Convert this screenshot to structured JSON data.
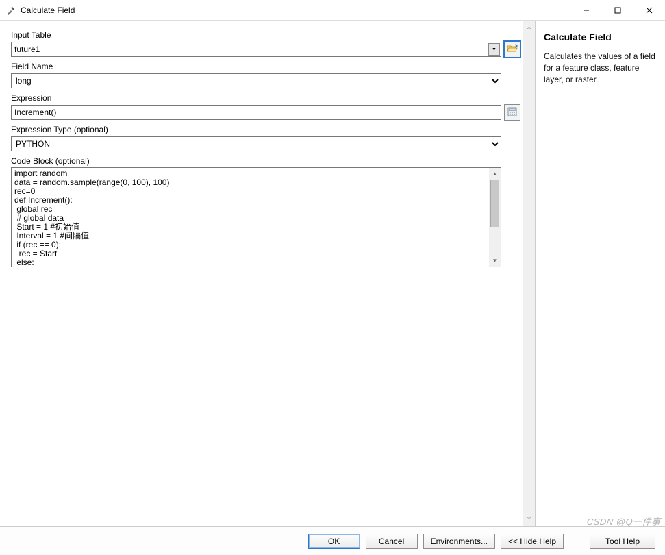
{
  "window": {
    "title": "Calculate Field"
  },
  "labels": {
    "input_table": "Input Table",
    "field_name": "Field Name",
    "expression": "Expression",
    "expression_type": "Expression Type (optional)",
    "code_block": "Code Block (optional)"
  },
  "values": {
    "input_table": "future1",
    "field_name": "long",
    "expression": "Increment()",
    "expression_type": "PYTHON",
    "code_block": "import random\ndata = random.sample(range(0, 100), 100)\nrec=0\ndef Increment():\n global rec\n # global data\n Start = 1 #初始值\n Interval = 1 #间隔值\n if (rec == 0):\n  rec = Start\n else:"
  },
  "buttons": {
    "ok": "OK",
    "cancel": "Cancel",
    "environments": "Environments...",
    "hide_help": "<< Hide Help",
    "tool_help": "Tool Help"
  },
  "help": {
    "title": "Calculate Field",
    "body": "Calculates the values of a field for a feature class, feature layer, or raster."
  },
  "watermark": "CSDN @Q一件事"
}
